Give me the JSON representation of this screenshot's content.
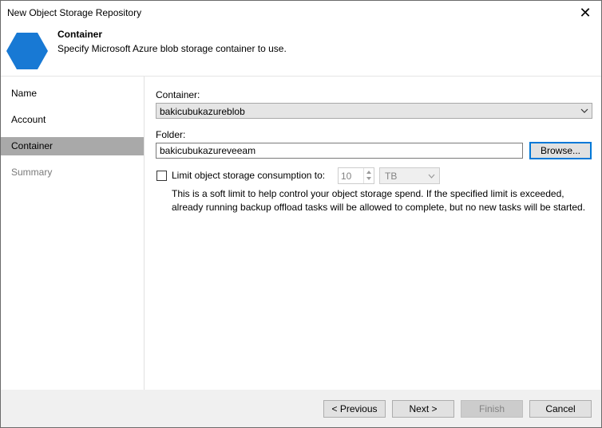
{
  "window": {
    "title": "New Object Storage Repository",
    "close_glyph": "✕"
  },
  "header": {
    "icon": "blue-hexagon-icon",
    "title": "Container",
    "description": "Specify Microsoft Azure blob storage container to use."
  },
  "sidebar": {
    "items": [
      {
        "label": "Name",
        "state": "normal"
      },
      {
        "label": "Account",
        "state": "normal"
      },
      {
        "label": "Container",
        "state": "active"
      },
      {
        "label": "Summary",
        "state": "disabled"
      }
    ]
  },
  "main": {
    "container_label": "Container:",
    "container_value": "bakicubukazureblob",
    "folder_label": "Folder:",
    "folder_value": "bakicubukazureveeam",
    "browse_label": "Browse...",
    "limit_label": "Limit object storage consumption to:",
    "limit_checked": false,
    "limit_value": "10",
    "limit_unit": "TB",
    "help_line1": "This is a soft limit to help control your object storage spend. If the specified limit is exceeded,",
    "help_line2": "already running backup offload tasks will be allowed to complete, but no new tasks will be started."
  },
  "footer": {
    "previous_label": "< Previous",
    "next_label": "Next >",
    "finish_label": "Finish",
    "cancel_label": "Cancel"
  },
  "colors": {
    "accent": "#0078d7",
    "hexagon": "#1879d4",
    "active_nav": "#a9a9a9"
  }
}
